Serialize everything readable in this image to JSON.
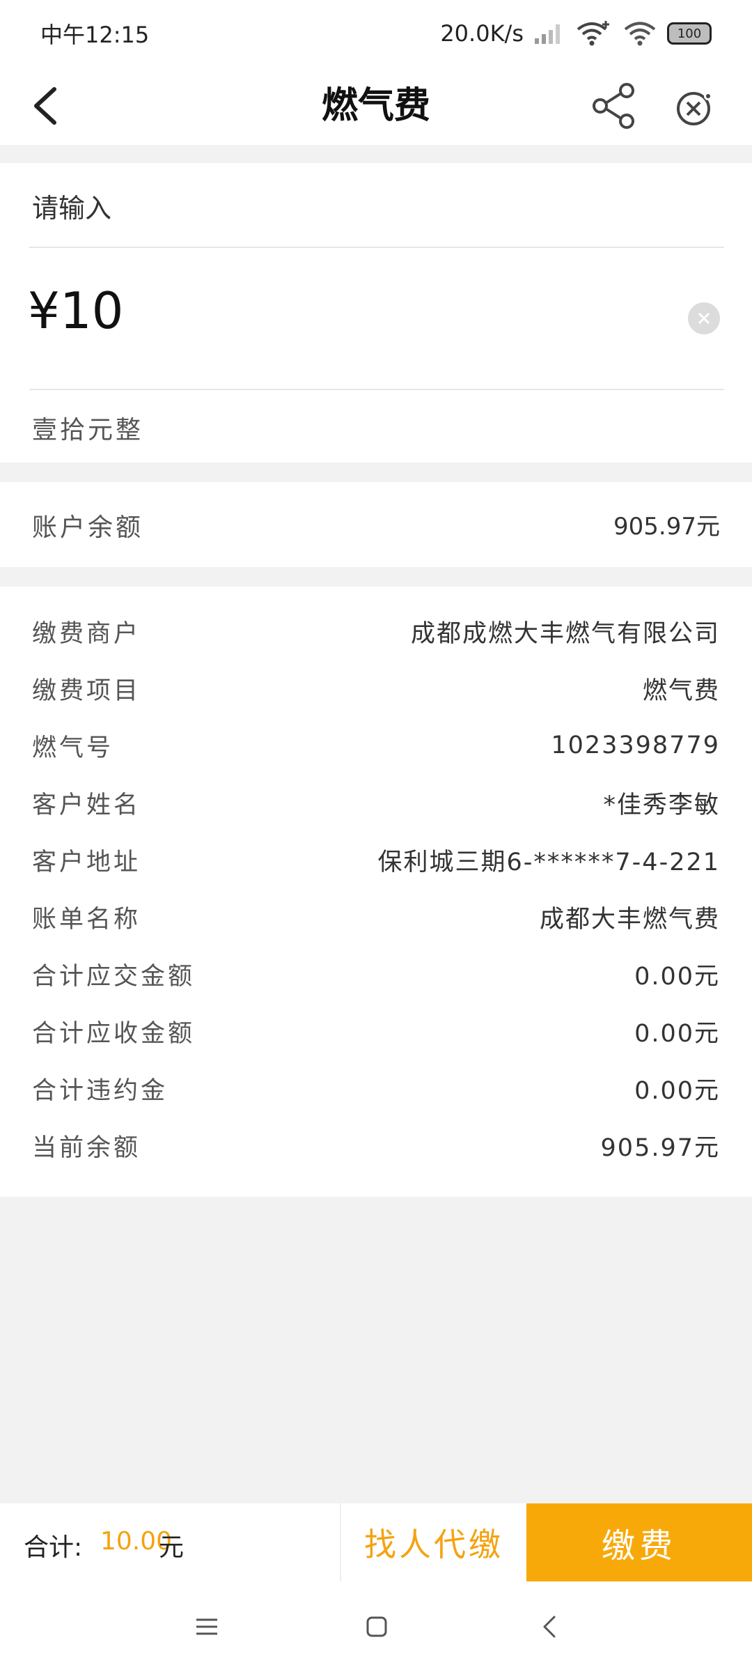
{
  "status_bar": {
    "time": "中午12:15",
    "net_speed": "20.0K/s",
    "battery": "100"
  },
  "header": {
    "title": "燃气费",
    "back_icon": "back-arrow-icon",
    "share_icon": "share-icon",
    "close_icon": "close-circle-icon"
  },
  "amount_input": {
    "prompt": "请输入",
    "currency": "¥",
    "amount": "10",
    "amount_in_words": "壹拾元整"
  },
  "balance": {
    "label": "账户余额",
    "value": "905.97元"
  },
  "details": [
    {
      "label": "缴费商户",
      "value": "成都成燃大丰燃气有限公司"
    },
    {
      "label": "缴费项目",
      "value": "燃气费"
    },
    {
      "label": "燃气号",
      "value": "1023398779"
    },
    {
      "label": "客户姓名",
      "value": "*佳秀李敏"
    },
    {
      "label": "客户地址",
      "value": "保利城三期6-******7-4-221"
    },
    {
      "label": "账单名称",
      "value": "成都大丰燃气费"
    },
    {
      "label": "合计应交金额",
      "value": "0.00元"
    },
    {
      "label": "合计应收金额",
      "value": "0.00元"
    },
    {
      "label": "合计违约金",
      "value": "0.00元"
    },
    {
      "label": "当前余额",
      "value": "905.97元"
    }
  ],
  "footer": {
    "total_label": "合计:",
    "total_amount": "10.00",
    "total_unit": "元",
    "proxy_button": "找人代缴",
    "pay_button": "缴费"
  },
  "colors": {
    "accent": "#f8a90a",
    "accent_text": "#f5a20f",
    "background": "#f2f2f2"
  }
}
